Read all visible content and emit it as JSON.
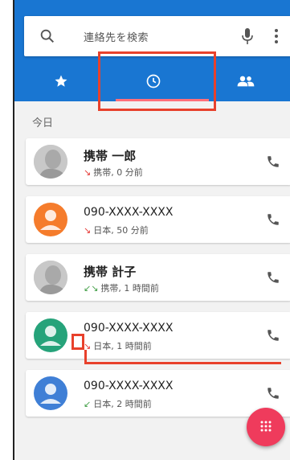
{
  "search": {
    "placeholder": "連絡先を検索"
  },
  "tabs": [
    {
      "name": "favorites",
      "icon": "star-icon"
    },
    {
      "name": "recents",
      "icon": "clock-icon",
      "selected": true
    },
    {
      "name": "contacts",
      "icon": "people-icon"
    }
  ],
  "section_label": "今日",
  "calls": [
    {
      "name": "携帯 一郎",
      "detail": "携帯, 0 分前",
      "arrows": "↘",
      "arrow_color": "#e53935",
      "avatar_color": "#bdbdbd",
      "photo": true
    },
    {
      "name": "090-XXXX-XXXX",
      "detail": "日本, 50 分前",
      "arrows": "↘",
      "arrow_color": "#e53935",
      "avatar_color": "#f57c2c",
      "photo": false
    },
    {
      "name": "携帯 計子",
      "detail": "携帯, 1 時間前",
      "arrows": "↙↘",
      "arrow_color": "#43a047",
      "avatar_color": "#bdbdbd",
      "photo": true
    },
    {
      "name": "090-XXXX-XXXX",
      "detail": "日本, 1 時間前",
      "arrows": "↘",
      "arrow_color": "#e53935",
      "avatar_color": "#26a37a",
      "photo": false
    },
    {
      "name": "090-XXXX-XXXX",
      "detail": "日本, 2 時間前",
      "arrows": "↙",
      "arrow_color": "#43a047",
      "avatar_color": "#3f7fd6",
      "photo": false
    }
  ],
  "colors": {
    "header": "#1976d2",
    "fab": "#ef3b5c",
    "annotation": "#e8412c"
  }
}
